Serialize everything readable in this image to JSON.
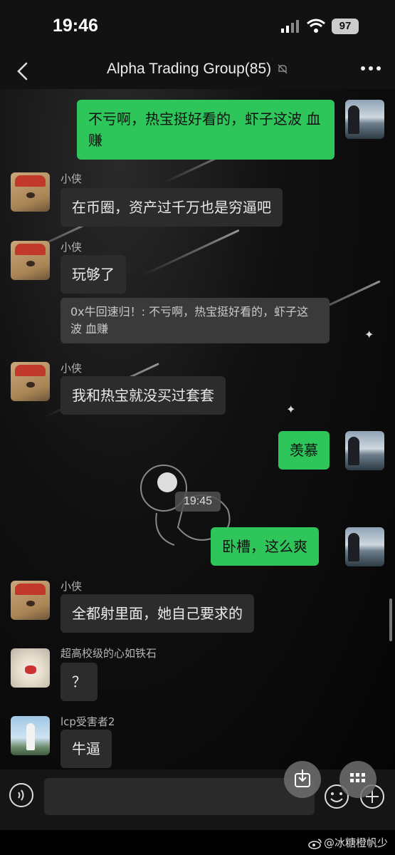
{
  "status_bar": {
    "time": "19:46",
    "battery": "97"
  },
  "nav": {
    "title": "Alpha Trading Group(85)"
  },
  "messages": [
    {
      "text": "不亏啊，热宝挺好看的，虾子这波 血赚"
    },
    {
      "name": "小侠",
      "text": "在币圈，资产过千万也是穷逼吧"
    },
    {
      "name": "小侠",
      "text": "玩够了",
      "quote": "0x牛回速归！: 不亏啊，热宝挺好看的，虾子这波 血赚"
    },
    {
      "name": "小侠",
      "text": "我和热宝就没买过套套"
    },
    {
      "text": "羡慕"
    },
    {
      "text": "卧槽，这么爽"
    },
    {
      "name": "小侠",
      "text": "全都射里面，她自己要求的"
    },
    {
      "name": "超高校级的心如铁石",
      "text": "？"
    },
    {
      "name": "lcp受害者2",
      "text": "牛逼"
    }
  ],
  "timestamp": "19:45",
  "input": {
    "placeholder": ""
  },
  "watermark": "@冰糖橙帆少",
  "colors": {
    "outgoing_bubble": "#2ec55b",
    "incoming_bubble": "#2c2c2c",
    "background": "#000000"
  },
  "icons": [
    "back-icon",
    "mute-icon",
    "more-icon",
    "voice-icon",
    "emoji-icon",
    "plus-icon",
    "download-icon",
    "grid-icon",
    "weibo-icon"
  ]
}
